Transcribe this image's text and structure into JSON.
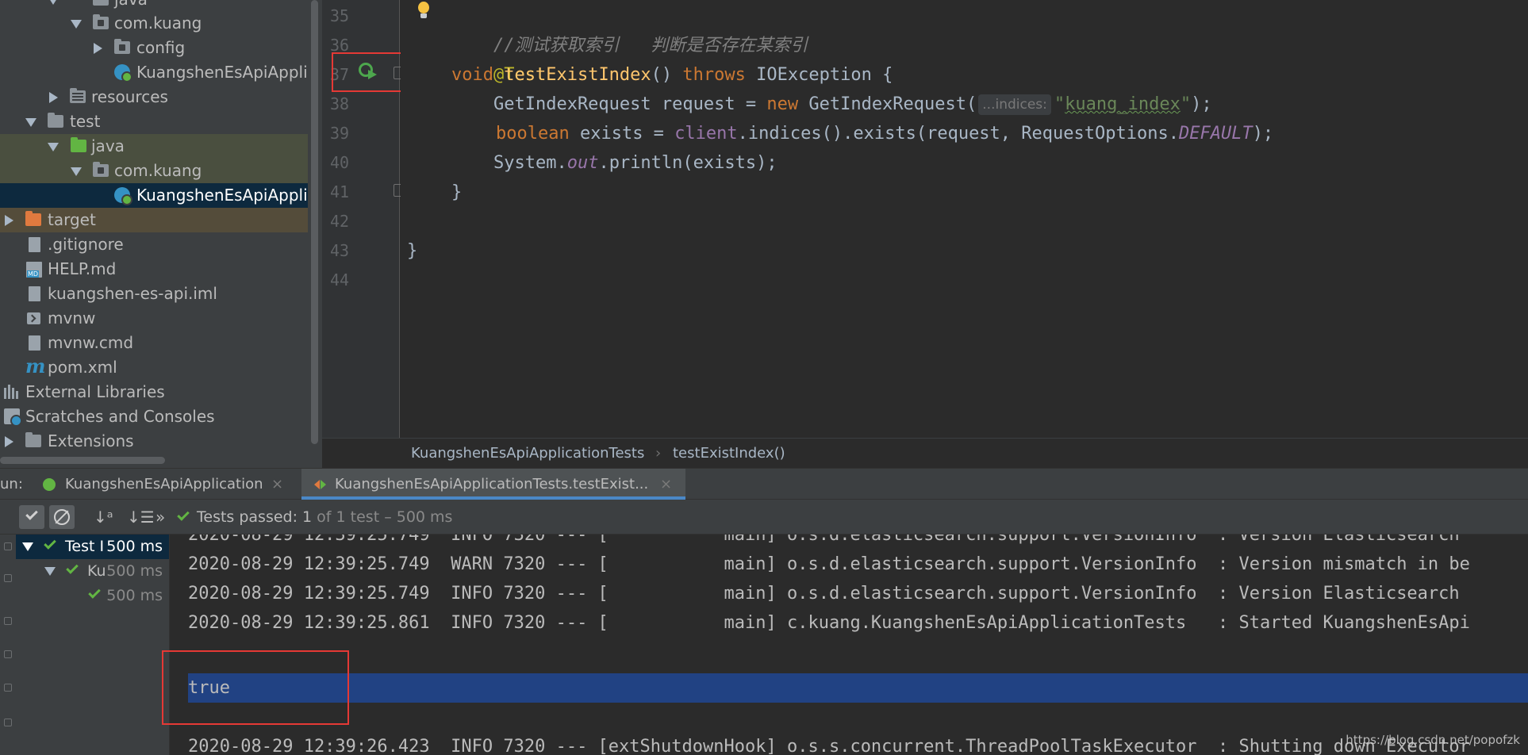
{
  "project_tree": {
    "items": [
      {
        "label": "java"
      },
      {
        "label": "com.kuang"
      },
      {
        "label": "config"
      },
      {
        "label": "KuangshenEsApiAppli"
      },
      {
        "label": "resources"
      },
      {
        "label": "test"
      },
      {
        "label": "java"
      },
      {
        "label": "com.kuang"
      },
      {
        "label": "KuangshenEsApiAppli"
      },
      {
        "label": "target"
      },
      {
        "label": ".gitignore"
      },
      {
        "label": "HELP.md"
      },
      {
        "label": "kuangshen-es-api.iml"
      },
      {
        "label": "mvnw"
      },
      {
        "label": "mvnw.cmd"
      },
      {
        "label": "pom.xml"
      },
      {
        "label": "External Libraries"
      },
      {
        "label": "Scratches and Consoles"
      },
      {
        "label": "Extensions"
      }
    ]
  },
  "editor": {
    "line_numbers": [
      "35",
      "36",
      "37",
      "38",
      "39",
      "40",
      "41",
      "42",
      "43",
      "44"
    ],
    "code": {
      "comment": "//测试获取索引   判断是否存在某索引",
      "annotation": "@Test",
      "l37_void": "void ",
      "l37_method": "testExistIndex",
      "l37_parens": "() ",
      "l37_throws": "throws ",
      "l37_rest": "IOException {",
      "l38_start": "    GetIndexRequest request = ",
      "l38_new": "new ",
      "l38_ctor": "GetIndexRequest(",
      "l38_hint": "...indices:",
      "l38_str_q1": "\"",
      "l38_str_body": "kuang_index",
      "l38_str_q2": "\"",
      "l38_end": ");",
      "l39_boolean": "boolean ",
      "l39_exists": "exists = ",
      "l39_client": "client",
      "l39_mid": ".indices().exists(request, RequestOptions.",
      "l39_default": "DEFAULT",
      "l39_end": ");",
      "l40_system": "    System.",
      "l40_out": "out",
      "l40_rest": ".println(exists);",
      "l41": "}",
      "l43": "}"
    }
  },
  "breadcrumb": {
    "class_name": "KuangshenEsApiApplicationTests",
    "separator": "›",
    "method_name": "testExistIndex()"
  },
  "run_panel": {
    "label": "un:",
    "tabs": [
      {
        "label": "KuangshenEsApiApplication"
      },
      {
        "label": "KuangshenEsApiApplicationTests.testExist..."
      }
    ],
    "close_glyph": "×",
    "status": {
      "prefix": "Tests passed: ",
      "passed": "1",
      "rest": " of 1 test – 500 ms"
    },
    "toolbar_glyphs": {
      "sort_alpha": "↓ᵃ",
      "sort_dur": "↓☰",
      "more": "»"
    },
    "test_tree": [
      {
        "label": "Test I",
        "duration": "500 ms"
      },
      {
        "label": "Ku",
        "duration": "500 ms"
      },
      {
        "label": "",
        "duration": "500 ms"
      }
    ],
    "console": [
      "2020-08-29 12:39:25.749  INFO 7320 --- [           main] o.s.d.elasticsearch.support.VersionInfo  : Version Elasticsearch",
      "2020-08-29 12:39:25.749  WARN 7320 --- [           main] o.s.d.elasticsearch.support.VersionInfo  : Version mismatch in be",
      "2020-08-29 12:39:25.749  INFO 7320 --- [           main] o.s.d.elasticsearch.support.VersionInfo  : Version Elasticsearch",
      "2020-08-29 12:39:25.861  INFO 7320 --- [           main] c.kuang.KuangshenEsApiApplicationTests   : Started KuangshenEsApi",
      "",
      "true",
      "",
      "2020-08-29 12:39:26.423  INFO 7320 --- [extShutdownHook] o.s.s.concurrent.ThreadPoolTaskExecutor  : Shutting down Executor"
    ]
  },
  "watermark": "https://blog.csdn.net/popofzk",
  "colors": {
    "highlight_box": "#e53935",
    "pass_green": "#62b543",
    "selection_blue": "#214283"
  }
}
